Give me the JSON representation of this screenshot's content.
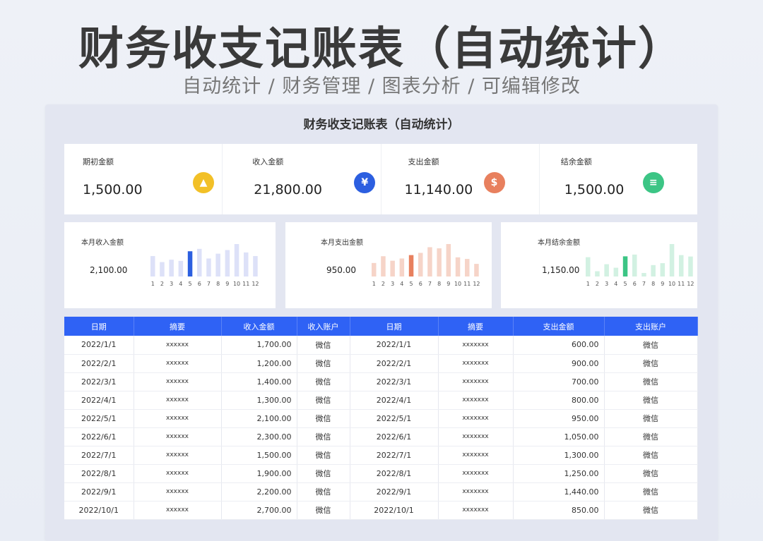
{
  "hero": {
    "title": "财务收支记账表（自动统计）",
    "subtitle": "自动统计 / 财务管理 / 图表分析 / 可编辑修改"
  },
  "sheet": {
    "title": "财务收支记账表（自动统计）"
  },
  "kpis": [
    {
      "label": "期初金额",
      "value": "1,500.00",
      "icon": "chart-icon",
      "color": "#f2c027",
      "glyph": "▲"
    },
    {
      "label": "收入金额",
      "value": "21,800.00",
      "icon": "yen-icon",
      "color": "#2c5fe0",
      "glyph": "¥"
    },
    {
      "label": "支出金额",
      "value": "11,140.00",
      "icon": "money-bag-icon",
      "color": "#e8805e",
      "glyph": "$"
    },
    {
      "label": "结余金额",
      "value": "1,500.00",
      "icon": "clipboard-icon",
      "color": "#3cc585",
      "glyph": "≡"
    }
  ],
  "charts": [
    {
      "label": "本月收入金额",
      "value": "2,100.00",
      "color": "#dde1f8",
      "highlight": "#2c5fe0",
      "highlight_month": 5,
      "months": [
        "1",
        "2",
        "3",
        "4",
        "5",
        "6",
        "7",
        "8",
        "9",
        "10",
        "11",
        "12"
      ],
      "values": [
        1700,
        1200,
        1400,
        1300,
        2100,
        2300,
        1500,
        1900,
        2200,
        2700,
        2000,
        1700
      ]
    },
    {
      "label": "本月支出金额",
      "value": "950.00",
      "color": "#f6d4c8",
      "highlight": "#e8805e",
      "highlight_month": 5,
      "months": [
        "1",
        "2",
        "3",
        "4",
        "5",
        "6",
        "7",
        "8",
        "9",
        "10",
        "11",
        "12"
      ],
      "values": [
        600,
        900,
        700,
        800,
        950,
        1050,
        1300,
        1250,
        1440,
        850,
        780,
        560
      ]
    },
    {
      "label": "本月结余金额",
      "value": "1,150.00",
      "color": "#d2f1e2",
      "highlight": "#3cc585",
      "highlight_month": 5,
      "months": [
        "1",
        "2",
        "3",
        "4",
        "5",
        "6",
        "7",
        "8",
        "9",
        "10",
        "11",
        "12"
      ],
      "values": [
        1100,
        300,
        700,
        500,
        1150,
        1250,
        200,
        650,
        760,
        1850,
        1220,
        1140
      ]
    }
  ],
  "table": {
    "headers": [
      "日期",
      "摘要",
      "收入金额",
      "收入账户",
      "日期",
      "摘要",
      "支出金额",
      "支出账户"
    ],
    "rows": [
      [
        "2022/1/1",
        "xxxxxx",
        "1,700.00",
        "微信",
        "2022/1/1",
        "xxxxxxx",
        "600.00",
        "微信"
      ],
      [
        "2022/2/1",
        "xxxxxx",
        "1,200.00",
        "微信",
        "2022/2/1",
        "xxxxxxx",
        "900.00",
        "微信"
      ],
      [
        "2022/3/1",
        "xxxxxx",
        "1,400.00",
        "微信",
        "2022/3/1",
        "xxxxxxx",
        "700.00",
        "微信"
      ],
      [
        "2022/4/1",
        "xxxxxx",
        "1,300.00",
        "微信",
        "2022/4/1",
        "xxxxxxx",
        "800.00",
        "微信"
      ],
      [
        "2022/5/1",
        "xxxxxx",
        "2,100.00",
        "微信",
        "2022/5/1",
        "xxxxxxx",
        "950.00",
        "微信"
      ],
      [
        "2022/6/1",
        "xxxxxx",
        "2,300.00",
        "微信",
        "2022/6/1",
        "xxxxxxx",
        "1,050.00",
        "微信"
      ],
      [
        "2022/7/1",
        "xxxxxx",
        "1,500.00",
        "微信",
        "2022/7/1",
        "xxxxxxx",
        "1,300.00",
        "微信"
      ],
      [
        "2022/8/1",
        "xxxxxx",
        "1,900.00",
        "微信",
        "2022/8/1",
        "xxxxxxx",
        "1,250.00",
        "微信"
      ],
      [
        "2022/9/1",
        "xxxxxx",
        "2,200.00",
        "微信",
        "2022/9/1",
        "xxxxxxx",
        "1,440.00",
        "微信"
      ],
      [
        "2022/10/1",
        "xxxxxx",
        "2,700.00",
        "微信",
        "2022/10/1",
        "xxxxxxx",
        "850.00",
        "微信"
      ]
    ]
  }
}
